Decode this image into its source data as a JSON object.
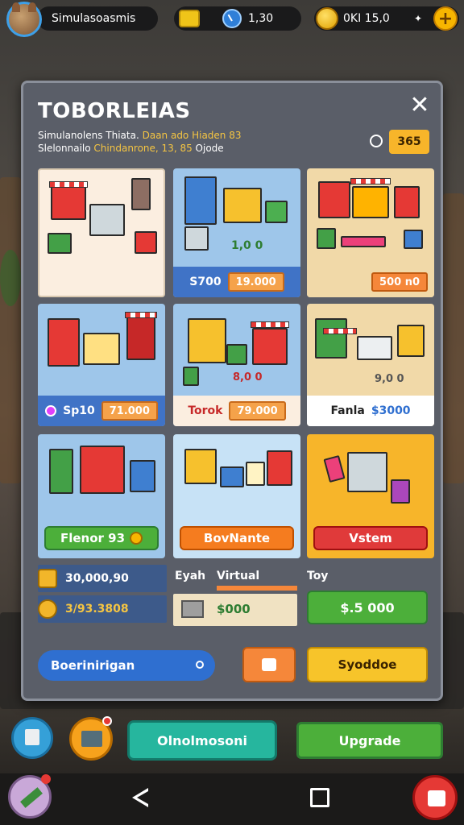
{
  "hud": {
    "player_name": "Simulasoasmis",
    "tickets_value": "1,30",
    "coins_value": "0KI 15,0",
    "coins_extra": "✦",
    "plus_label": "+"
  },
  "panel": {
    "title": "TOBORLEIAS",
    "close_label": "✕",
    "subtitle_line1_a": "Simulanolens  Thiata.",
    "subtitle_line1_b": "Daan ado  Hiaden 83",
    "subtitle_line2_a": "Slelonnailo",
    "subtitle_line2_b": "Chindanrone, 13, 85",
    "subtitle_line2_c": "Ojode",
    "price_tag": "365"
  },
  "cards": [
    {
      "id": "c1",
      "label": "",
      "button": ""
    },
    {
      "id": "c2",
      "label": "S700",
      "button": "19.000",
      "art_text": "1,0 0"
    },
    {
      "id": "c3",
      "label": "",
      "button": "500 n0"
    },
    {
      "id": "c4",
      "label": "Sp10",
      "button": "71.000"
    },
    {
      "id": "c5",
      "label": "Torok",
      "button": "79.000",
      "art_text": "8,0 0"
    },
    {
      "id": "c6",
      "label": "Fanla",
      "button": "$3000",
      "art_text": "9,0 0"
    },
    {
      "id": "c7",
      "button": "Flenor  93"
    },
    {
      "id": "c8",
      "button": "BovNante"
    },
    {
      "id": "c9",
      "button": "Vstem"
    }
  ],
  "summary": {
    "stat1": "30,000,90",
    "stat2": "3/93.3808",
    "mid_label_a": "Eyah",
    "mid_label_b": "Virtual",
    "mid_value": "$000",
    "right_label": "Toy",
    "right_button": "$.5 000"
  },
  "panel_footer": {
    "search_label": "Boerinirigan",
    "gift_label": "",
    "upgrade_small": "Syoddoe"
  },
  "bottom_bar": {
    "teal_button": "Olnolmosoni",
    "green_button": "Upgrade"
  },
  "colors": {
    "accent_gold": "#f7b52a",
    "accent_green": "#4caf3a",
    "accent_orange": "#f5873a",
    "accent_red": "#e03a3a",
    "accent_blue": "#2f6fd0"
  }
}
